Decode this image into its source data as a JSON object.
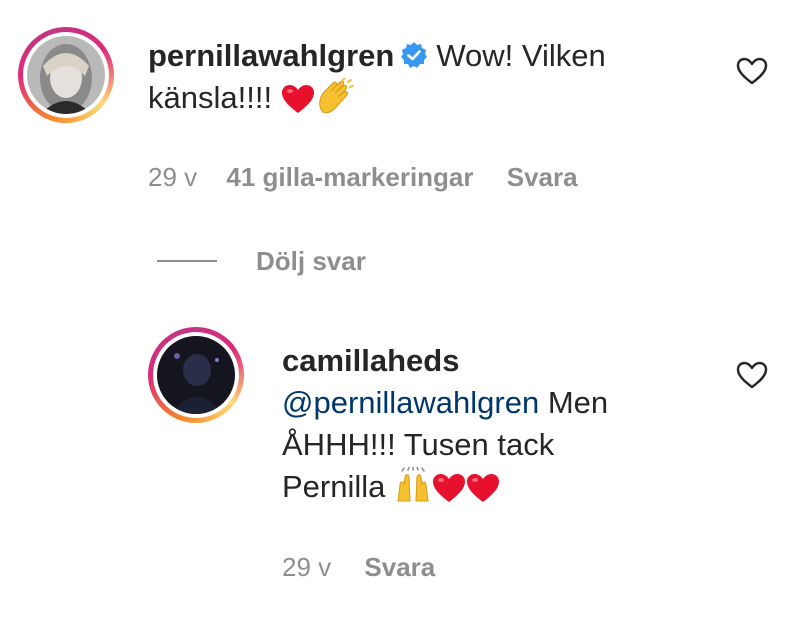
{
  "comment": {
    "username": "pernillawahlgren",
    "text_part1": "Wow! Vilken",
    "text_part2": "känsla!!!!",
    "emojis": [
      "red-heart",
      "clapping-hands"
    ],
    "time": "29 v",
    "likes": "41 gilla-markeringar",
    "reply_label": "Svara",
    "verified": true
  },
  "thread": {
    "hide_replies_label": "Dölj svar"
  },
  "reply": {
    "username": "camillaheds",
    "mention": "@pernillawahlgren",
    "text_line1": "Men",
    "text_line2": "ÅHHH!!! Tusen tack",
    "text_line3": "Pernilla",
    "emojis": [
      "raising-hands",
      "red-heart",
      "red-heart"
    ],
    "time": "29 v",
    "reply_label": "Svara"
  },
  "colors": {
    "text": "#262626",
    "meta": "#8e8e8e",
    "mention": "#00376b",
    "verified": "#3897f0",
    "heart": "#e0245e",
    "story_ring_start": "#f58529",
    "story_ring_end": "#dd2a7b"
  }
}
